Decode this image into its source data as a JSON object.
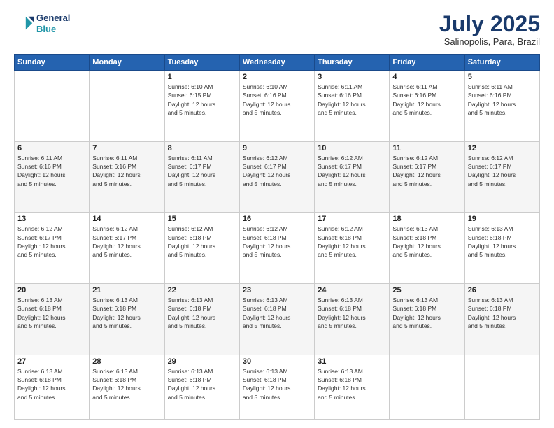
{
  "header": {
    "logo_line1": "General",
    "logo_line2": "Blue",
    "title": "July 2025",
    "location": "Salinopolis, Para, Brazil"
  },
  "weekdays": [
    "Sunday",
    "Monday",
    "Tuesday",
    "Wednesday",
    "Thursday",
    "Friday",
    "Saturday"
  ],
  "weeks": [
    [
      {
        "day": "",
        "info": ""
      },
      {
        "day": "",
        "info": ""
      },
      {
        "day": "1",
        "info": "Sunrise: 6:10 AM\nSunset: 6:15 PM\nDaylight: 12 hours\nand 5 minutes."
      },
      {
        "day": "2",
        "info": "Sunrise: 6:10 AM\nSunset: 6:16 PM\nDaylight: 12 hours\nand 5 minutes."
      },
      {
        "day": "3",
        "info": "Sunrise: 6:11 AM\nSunset: 6:16 PM\nDaylight: 12 hours\nand 5 minutes."
      },
      {
        "day": "4",
        "info": "Sunrise: 6:11 AM\nSunset: 6:16 PM\nDaylight: 12 hours\nand 5 minutes."
      },
      {
        "day": "5",
        "info": "Sunrise: 6:11 AM\nSunset: 6:16 PM\nDaylight: 12 hours\nand 5 minutes."
      }
    ],
    [
      {
        "day": "6",
        "info": "Sunrise: 6:11 AM\nSunset: 6:16 PM\nDaylight: 12 hours\nand 5 minutes."
      },
      {
        "day": "7",
        "info": "Sunrise: 6:11 AM\nSunset: 6:16 PM\nDaylight: 12 hours\nand 5 minutes."
      },
      {
        "day": "8",
        "info": "Sunrise: 6:11 AM\nSunset: 6:17 PM\nDaylight: 12 hours\nand 5 minutes."
      },
      {
        "day": "9",
        "info": "Sunrise: 6:12 AM\nSunset: 6:17 PM\nDaylight: 12 hours\nand 5 minutes."
      },
      {
        "day": "10",
        "info": "Sunrise: 6:12 AM\nSunset: 6:17 PM\nDaylight: 12 hours\nand 5 minutes."
      },
      {
        "day": "11",
        "info": "Sunrise: 6:12 AM\nSunset: 6:17 PM\nDaylight: 12 hours\nand 5 minutes."
      },
      {
        "day": "12",
        "info": "Sunrise: 6:12 AM\nSunset: 6:17 PM\nDaylight: 12 hours\nand 5 minutes."
      }
    ],
    [
      {
        "day": "13",
        "info": "Sunrise: 6:12 AM\nSunset: 6:17 PM\nDaylight: 12 hours\nand 5 minutes."
      },
      {
        "day": "14",
        "info": "Sunrise: 6:12 AM\nSunset: 6:17 PM\nDaylight: 12 hours\nand 5 minutes."
      },
      {
        "day": "15",
        "info": "Sunrise: 6:12 AM\nSunset: 6:18 PM\nDaylight: 12 hours\nand 5 minutes."
      },
      {
        "day": "16",
        "info": "Sunrise: 6:12 AM\nSunset: 6:18 PM\nDaylight: 12 hours\nand 5 minutes."
      },
      {
        "day": "17",
        "info": "Sunrise: 6:12 AM\nSunset: 6:18 PM\nDaylight: 12 hours\nand 5 minutes."
      },
      {
        "day": "18",
        "info": "Sunrise: 6:13 AM\nSunset: 6:18 PM\nDaylight: 12 hours\nand 5 minutes."
      },
      {
        "day": "19",
        "info": "Sunrise: 6:13 AM\nSunset: 6:18 PM\nDaylight: 12 hours\nand 5 minutes."
      }
    ],
    [
      {
        "day": "20",
        "info": "Sunrise: 6:13 AM\nSunset: 6:18 PM\nDaylight: 12 hours\nand 5 minutes."
      },
      {
        "day": "21",
        "info": "Sunrise: 6:13 AM\nSunset: 6:18 PM\nDaylight: 12 hours\nand 5 minutes."
      },
      {
        "day": "22",
        "info": "Sunrise: 6:13 AM\nSunset: 6:18 PM\nDaylight: 12 hours\nand 5 minutes."
      },
      {
        "day": "23",
        "info": "Sunrise: 6:13 AM\nSunset: 6:18 PM\nDaylight: 12 hours\nand 5 minutes."
      },
      {
        "day": "24",
        "info": "Sunrise: 6:13 AM\nSunset: 6:18 PM\nDaylight: 12 hours\nand 5 minutes."
      },
      {
        "day": "25",
        "info": "Sunrise: 6:13 AM\nSunset: 6:18 PM\nDaylight: 12 hours\nand 5 minutes."
      },
      {
        "day": "26",
        "info": "Sunrise: 6:13 AM\nSunset: 6:18 PM\nDaylight: 12 hours\nand 5 minutes."
      }
    ],
    [
      {
        "day": "27",
        "info": "Sunrise: 6:13 AM\nSunset: 6:18 PM\nDaylight: 12 hours\nand 5 minutes."
      },
      {
        "day": "28",
        "info": "Sunrise: 6:13 AM\nSunset: 6:18 PM\nDaylight: 12 hours\nand 5 minutes."
      },
      {
        "day": "29",
        "info": "Sunrise: 6:13 AM\nSunset: 6:18 PM\nDaylight: 12 hours\nand 5 minutes."
      },
      {
        "day": "30",
        "info": "Sunrise: 6:13 AM\nSunset: 6:18 PM\nDaylight: 12 hours\nand 5 minutes."
      },
      {
        "day": "31",
        "info": "Sunrise: 6:13 AM\nSunset: 6:18 PM\nDaylight: 12 hours\nand 5 minutes."
      },
      {
        "day": "",
        "info": ""
      },
      {
        "day": "",
        "info": ""
      }
    ]
  ]
}
